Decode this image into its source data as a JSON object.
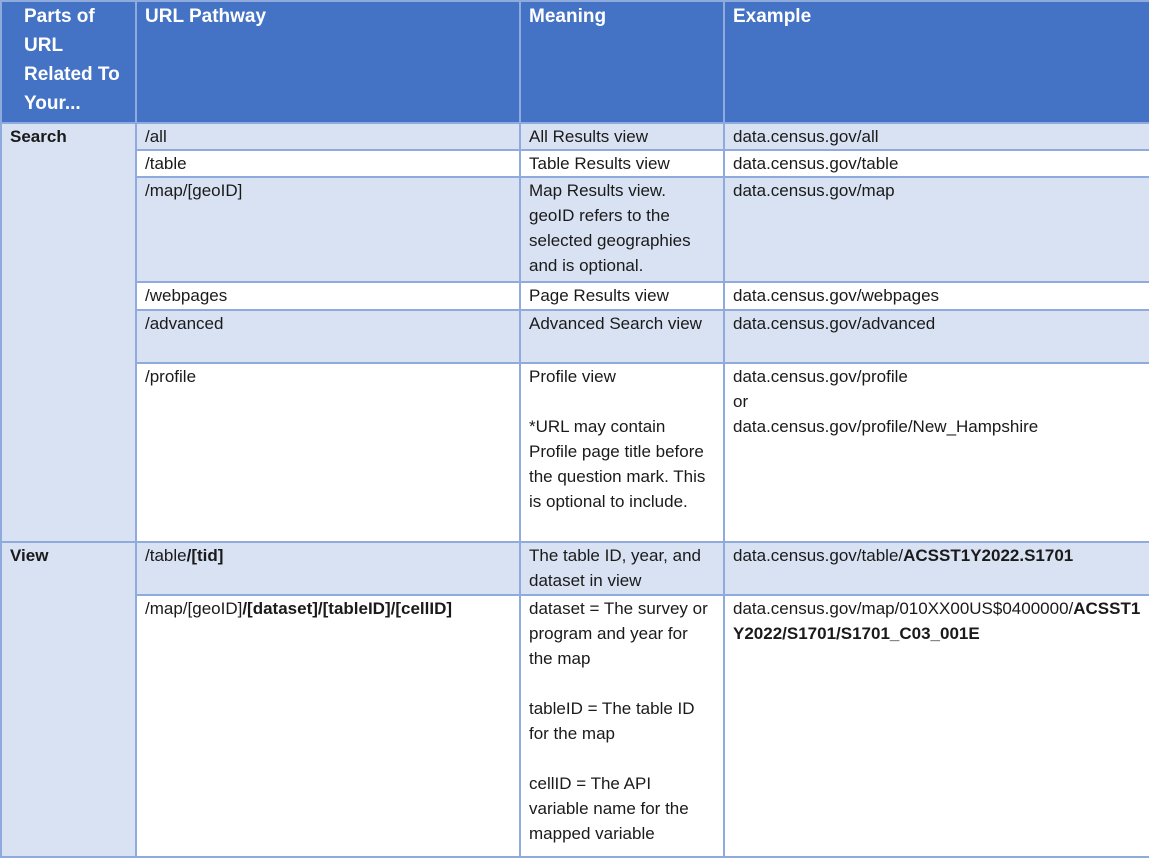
{
  "headers": {
    "parts": "Parts of URL Related To Your...",
    "pathway": "URL Pathway",
    "meaning": "Meaning",
    "example": "Example"
  },
  "groups": {
    "search": "Search",
    "view": "View"
  },
  "search_rows": [
    {
      "path": "/all",
      "meaning": "All Results view",
      "example": "data.census.gov/all"
    },
    {
      "path": "/table",
      "meaning": "Table Results view",
      "example": "data.census.gov/table"
    },
    {
      "path": "/map/[geoID]",
      "meaning": "Map Results view. geoID refers to the selected geographies and is optional.",
      "example": "data.census.gov/map"
    },
    {
      "path": "/webpages",
      "meaning": "Page Results view",
      "example": "data.census.gov/webpages"
    },
    {
      "path": "/advanced",
      "meaning": "Advanced Search view",
      "example": "data.census.gov/advanced"
    },
    {
      "path": "/profile",
      "meaning_1": "Profile view",
      "meaning_2": "*URL may contain Profile page title before the question mark. This is optional to include.",
      "example_1": "data.census.gov/profile",
      "example_or": "or",
      "example_2": "data.census.gov/profile/New_Hampshire"
    }
  ],
  "view_rows": [
    {
      "path_plain": "/table",
      "path_bold": "/[tid]",
      "meaning": "The table ID, year, and dataset in view",
      "example_plain": "data.census.gov/table/",
      "example_bold": "ACSST1Y2022.S1701"
    },
    {
      "path_plain": "/map/[geoID]",
      "path_bold": "/[dataset]/[tableID]/[cellID]",
      "meaning_1": "dataset = The survey or program and year for the map",
      "meaning_2": "tableID = The table ID for the map",
      "meaning_3": "cellID = The API variable name for the mapped variable",
      "example_plain": "data.census.gov/map/010XX00US$0400000/",
      "example_bold": "ACSST1Y2022/S1701/S1701_C03_001E"
    }
  ]
}
